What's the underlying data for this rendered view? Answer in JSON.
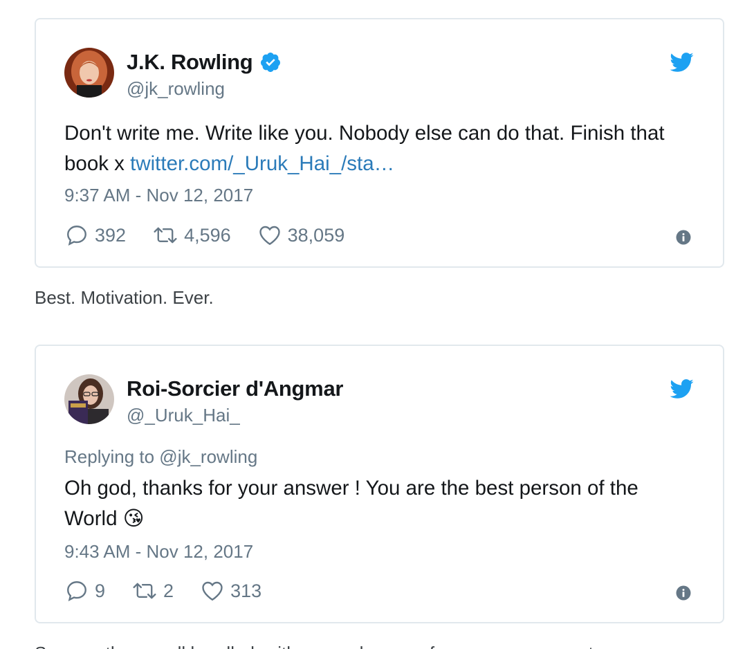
{
  "tweets": [
    {
      "display_name": "J.K. Rowling",
      "handle": "@jk_rowling",
      "verified": true,
      "text": "Don't write me. Write like you. Nobody else can do that. Finish that book x ",
      "link": "twitter.com/_Uruk_Hai_/sta…",
      "timestamp": "9:37 AM - Nov 12, 2017",
      "replies": "392",
      "retweets": "4,596",
      "likes": "38,059",
      "icons": [
        "verified-badge-icon",
        "twitter-bird-icon",
        "reply-icon",
        "retweet-icon",
        "like-icon",
        "info-icon"
      ]
    },
    {
      "display_name": "Roi-Sorcier d'Angmar",
      "handle": "@_Uruk_Hai_",
      "replying_to": "Replying to @jk_rowling",
      "text": "Oh god, thanks for your answer ! You are the best person of the World ",
      "emoji": "😘",
      "timestamp": "9:43 AM - Nov 12, 2017",
      "replies": "9",
      "retweets": "2",
      "likes": "313",
      "icons": [
        "twitter-bird-icon",
        "reply-icon",
        "retweet-icon",
        "like-icon",
        "info-icon"
      ]
    }
  ],
  "caption": "Best. Motivation. Ever.",
  "cut_off_text": "So smooth, so well handled, with so much grace, for so many moments…",
  "colors": {
    "twitter_blue": "#1da1f2",
    "link": "#2b7bb9",
    "muted": "#657786",
    "border": "#e1e8ed",
    "text": "#14171a"
  }
}
